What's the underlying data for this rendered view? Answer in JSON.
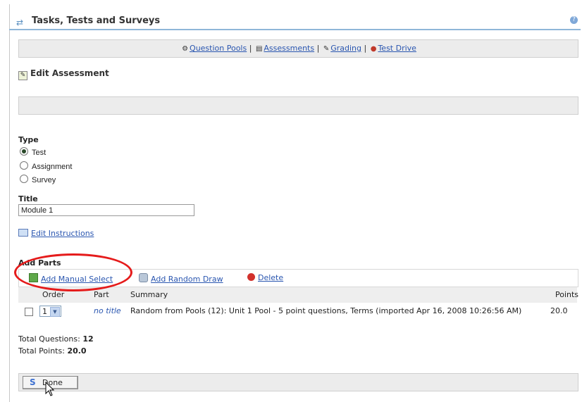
{
  "header": {
    "title": "Tasks, Tests and Surveys",
    "help_icon": "help-icon"
  },
  "nav": {
    "items": [
      {
        "label": "Question Pools",
        "icon": "question-pools-icon"
      },
      {
        "label": "Assessments",
        "icon": "assessments-icon"
      },
      {
        "label": "Grading",
        "icon": "grading-icon"
      },
      {
        "label": "Test Drive",
        "icon": "test-drive-icon"
      }
    ],
    "separator": "|"
  },
  "page": {
    "heading": "Edit Assessment"
  },
  "type": {
    "label": "Type",
    "options": [
      {
        "label": "Test",
        "checked": true
      },
      {
        "label": "Assignment",
        "checked": false
      },
      {
        "label": "Survey",
        "checked": false
      }
    ]
  },
  "title_field": {
    "label": "Title",
    "value": "Module 1"
  },
  "edit_instructions": {
    "label": "Edit Instructions"
  },
  "parts": {
    "label": "Add Parts",
    "actions": {
      "add_manual": "Add Manual Select",
      "add_random": "Add Random Draw",
      "delete": "Delete"
    },
    "columns": {
      "order": "Order",
      "part": "Part",
      "summary": "Summary",
      "points": "Points"
    },
    "rows": [
      {
        "order": "1",
        "part": "no title",
        "summary": "Random from Pools (12): Unit 1 Pool - 5 point questions, Terms (imported Apr 16, 2008 10:26:56 AM)",
        "points": "20.0"
      }
    ]
  },
  "totals": {
    "questions_label": "Total Questions:",
    "questions_value": "12",
    "points_label": "Total Points:",
    "points_value": "20.0"
  },
  "footer": {
    "done_label": "Done"
  },
  "colors": {
    "link": "#2a56b0",
    "annotation": "#e51b1b",
    "bar": "#ececec",
    "header_rule": "#8fb6d8"
  }
}
